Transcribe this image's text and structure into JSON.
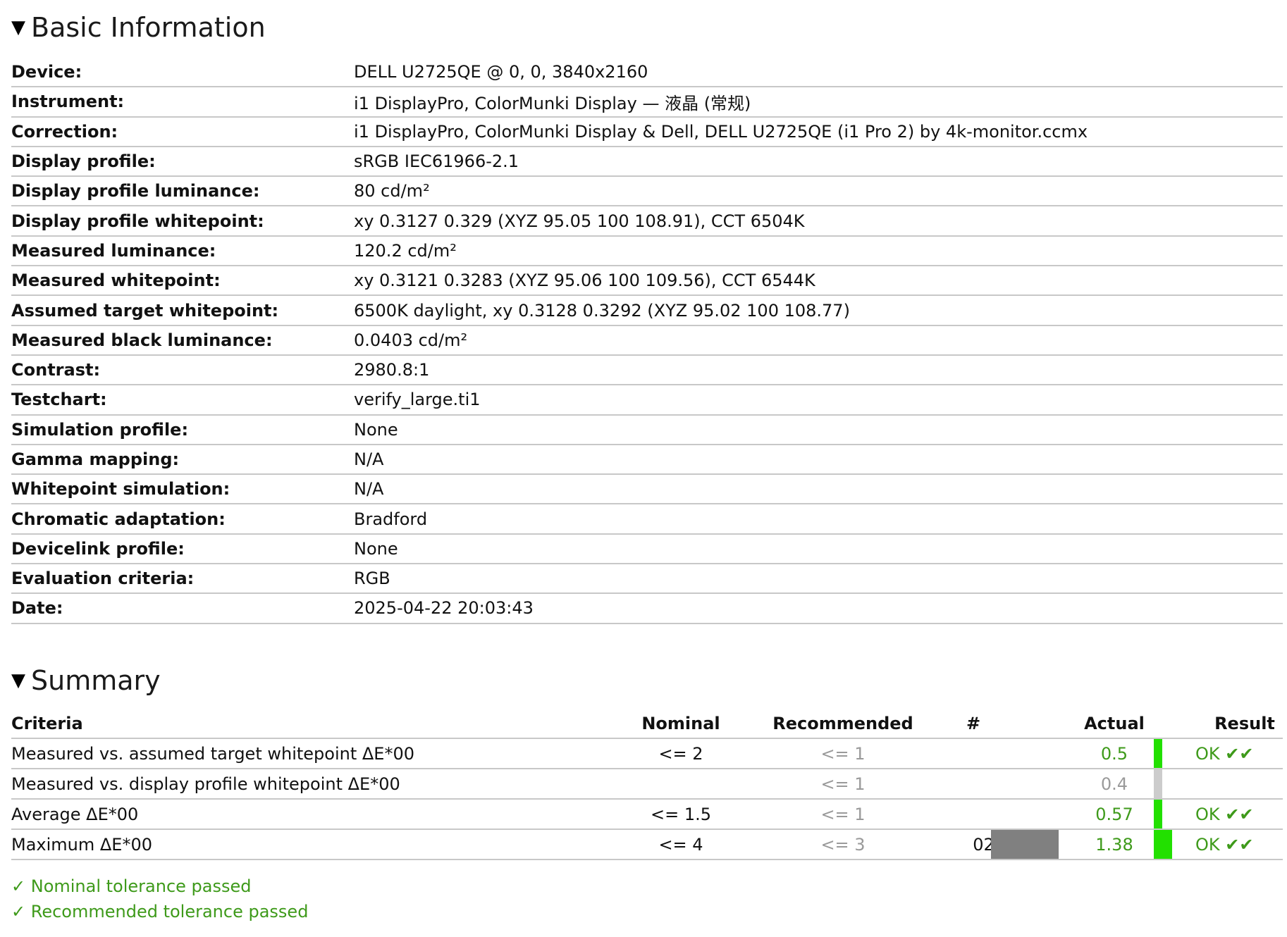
{
  "basic": {
    "title": "Basic Information",
    "rows": [
      {
        "label": "Device:",
        "value": "DELL U2725QE @ 0, 0, 3840x2160"
      },
      {
        "label": "Instrument:",
        "value": "i1 DisplayPro, ColorMunki Display — 液晶 (常规)"
      },
      {
        "label": "Correction:",
        "value": "i1 DisplayPro, ColorMunki Display & Dell, DELL U2725QE (i1 Pro 2) by 4k-monitor.ccmx"
      },
      {
        "label": "Display profile:",
        "value": "sRGB IEC61966-2.1"
      },
      {
        "label": "Display profile luminance:",
        "value": "80 cd/m²"
      },
      {
        "label": "Display profile whitepoint:",
        "value": "xy 0.3127 0.329 (XYZ 95.05 100 108.91), CCT 6504K"
      },
      {
        "label": "Measured luminance:",
        "value": "120.2 cd/m²"
      },
      {
        "label": "Measured whitepoint:",
        "value": "xy 0.3121 0.3283 (XYZ 95.06 100 109.56), CCT 6544K"
      },
      {
        "label": "Assumed target whitepoint:",
        "value": "6500K daylight, xy 0.3128 0.3292 (XYZ 95.02 100 108.77)"
      },
      {
        "label": "Measured black luminance:",
        "value": "0.0403 cd/m²"
      },
      {
        "label": "Contrast:",
        "value": "2980.8:1"
      },
      {
        "label": "Testchart:",
        "value": "verify_large.ti1"
      },
      {
        "label": "Simulation profile:",
        "value": "None"
      },
      {
        "label": "Gamma mapping:",
        "value": "N/A"
      },
      {
        "label": "Whitepoint simulation:",
        "value": "N/A"
      },
      {
        "label": "Chromatic adaptation:",
        "value": "Bradford"
      },
      {
        "label": "Devicelink profile:",
        "value": "None"
      },
      {
        "label": "Evaluation criteria:",
        "value": "RGB"
      },
      {
        "label": "Date:",
        "value": "2025-04-22 20:03:43"
      }
    ]
  },
  "summary": {
    "title": "Summary",
    "headers": {
      "criteria": "Criteria",
      "nominal": "Nominal",
      "recommended": "Recommended",
      "hash": "#",
      "actual": "Actual",
      "result": "Result"
    },
    "rows": [
      {
        "criteria": "Measured vs. assumed target whitepoint ΔE*00",
        "nominal": "<= 2",
        "recommended": "<= 1",
        "hash": "",
        "actual": "0.5",
        "result": "OK ✔✔"
      },
      {
        "criteria": "Measured vs. display profile whitepoint ΔE*00",
        "nominal": "",
        "recommended": "<= 1",
        "hash": "",
        "actual": "0.4",
        "result": ""
      },
      {
        "criteria": "Average ΔE*00",
        "nominal": "<= 1.5",
        "recommended": "<= 1",
        "hash": "",
        "actual": "0.57",
        "result": "OK ✔✔"
      },
      {
        "criteria": "Maximum ΔE*00",
        "nominal": "<= 4",
        "recommended": "<= 3",
        "hash": "023",
        "actual": "1.38",
        "result": "OK ✔✔"
      }
    ],
    "notes": [
      "✓ Nominal tolerance passed",
      "✓ Recommended tolerance passed"
    ]
  },
  "colors": {
    "pass_green": "#3e9a1a",
    "bar_green": "#22e000",
    "bar_gray": "#cccccc",
    "swatch_gray": "#808080",
    "muted_text": "#9a9a9a",
    "rule": "#c8c8c8"
  },
  "icons": {
    "expand": "triangle-down-icon",
    "check": "check-icon"
  }
}
